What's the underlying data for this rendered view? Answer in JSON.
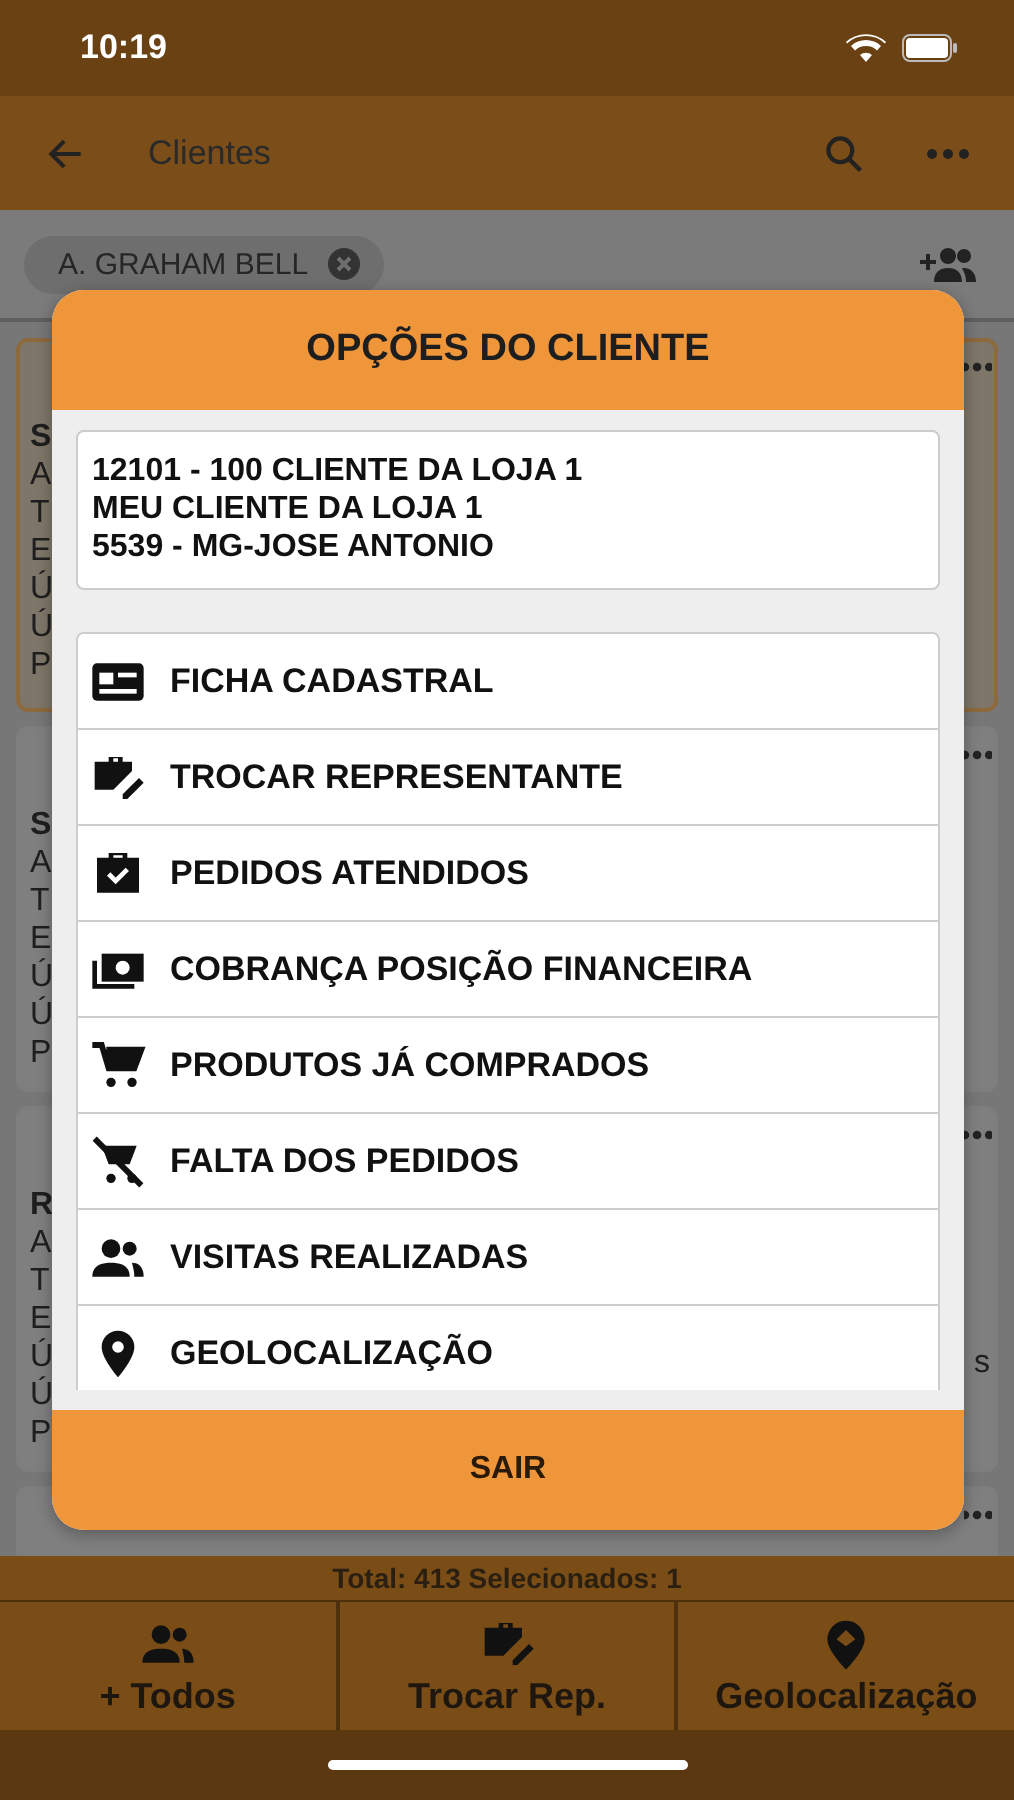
{
  "status_bar": {
    "time": "10:19"
  },
  "app_bar": {
    "title": "Clientes"
  },
  "filter_chip": {
    "label": "A. GRAHAM BELL"
  },
  "background_cards": [
    {
      "selected": true,
      "lines": [
        "S",
        "A",
        "T",
        "E",
        "Ú",
        "Ú",
        "P"
      ]
    },
    {
      "selected": false,
      "lines": [
        "S",
        "A",
        "T",
        "E",
        "Ú",
        "Ú",
        "P"
      ]
    },
    {
      "selected": false,
      "lines": [
        "R",
        "A",
        "T",
        "E",
        "Ú",
        "Ú",
        "P"
      ],
      "right_text": "s"
    },
    {
      "selected": false
    }
  ],
  "dialog": {
    "title": "OPÇÕES DO CLIENTE",
    "info_lines": [
      "12101 - 100 CLIENTE DA LOJA 1",
      "MEU CLIENTE DA LOJA 1",
      "5539 - MG-JOSE ANTONIO"
    ],
    "options": [
      {
        "kind": "id-card",
        "label": "FICHA CADASTRAL"
      },
      {
        "kind": "briefcase-edit",
        "label": "TROCAR REPRESENTANTE"
      },
      {
        "kind": "briefcase-check",
        "label": "PEDIDOS ATENDIDOS"
      },
      {
        "kind": "cash",
        "label": "COBRANÇA POSIÇÃO FINANCEIRA"
      },
      {
        "kind": "cart",
        "label": "PRODUTOS JÁ COMPRADOS"
      },
      {
        "kind": "cart-off",
        "label": "FALTA DOS PEDIDOS"
      },
      {
        "kind": "people",
        "label": "VISITAS REALIZADAS"
      },
      {
        "kind": "pin",
        "label": "GEOLOCALIZAÇÃO"
      }
    ],
    "exit_button": "SAIR"
  },
  "summary": "Total: 413 Selecionados: 1",
  "footer_actions": [
    {
      "kind": "people",
      "label": "+ Todos"
    },
    {
      "kind": "briefcase-edit",
      "label": "Trocar Rep."
    },
    {
      "kind": "map-pin",
      "label": "Geolocalização"
    }
  ]
}
